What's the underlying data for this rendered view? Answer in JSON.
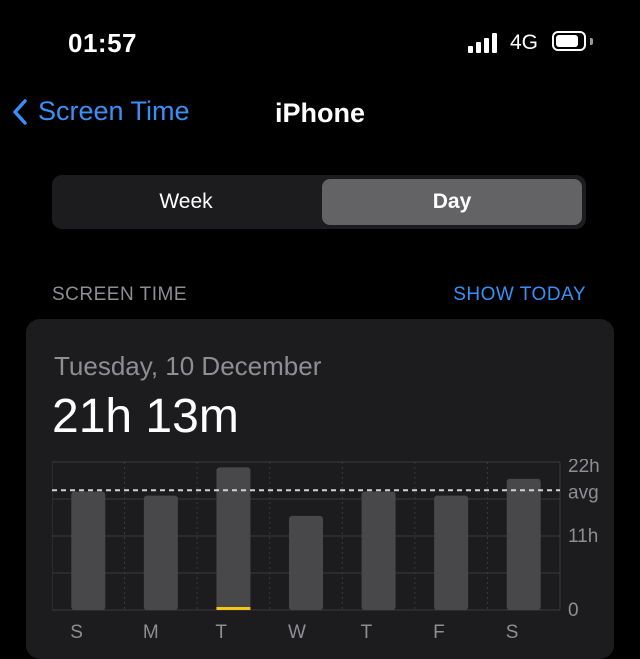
{
  "status": {
    "time": "01:57",
    "network": "4G",
    "battery_level": 0.85
  },
  "nav": {
    "back_label": "Screen Time",
    "title": "iPhone"
  },
  "segments": {
    "week": "Week",
    "day": "Day",
    "selected": "Day"
  },
  "section": {
    "header": "SCREEN TIME",
    "action": "SHOW TODAY"
  },
  "summary": {
    "date": "Tuesday, 10 December",
    "total": "21h 13m"
  },
  "chart_data": {
    "type": "bar",
    "categories": [
      "S",
      "M",
      "T",
      "W",
      "T",
      "F",
      "S"
    ],
    "values": [
      17.6,
      17.0,
      21.2,
      14.0,
      17.6,
      17.0,
      19.5
    ],
    "highlight_index": 2,
    "avg": 17.8,
    "ylim": [
      0,
      22
    ],
    "yticks": [
      {
        "value": 22,
        "label": "22h"
      },
      {
        "value": 11,
        "label": "11h"
      },
      {
        "value": 0,
        "label": "0"
      }
    ],
    "avg_label": "avg",
    "colors": {
      "bar": "#48484a",
      "highlight": "#f5c518",
      "grid": "#3a3a3c"
    }
  }
}
